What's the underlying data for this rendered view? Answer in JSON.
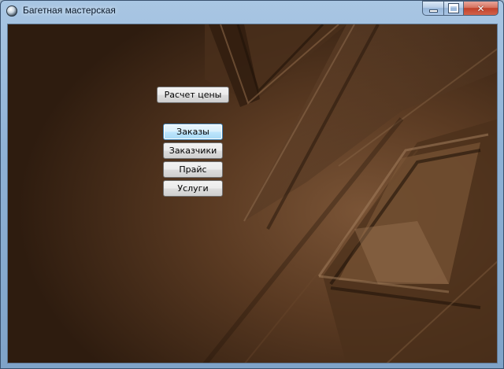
{
  "window": {
    "title": "Багетная мастерская",
    "controls": {
      "minimize": "minimize",
      "maximize": "maximize",
      "close": "✕"
    }
  },
  "main": {
    "price_button": "Расчет цены",
    "menu": [
      {
        "id": "orders",
        "label": "Заказы",
        "focused": true
      },
      {
        "id": "customers",
        "label": "Заказчики",
        "focused": false
      },
      {
        "id": "price-list",
        "label": "Прайс",
        "focused": false
      },
      {
        "id": "services",
        "label": "Услуги",
        "focused": false
      }
    ]
  },
  "colors": {
    "background_dark": "#3a2414",
    "background_light": "#7a5436",
    "focus_border": "#3c7fb1"
  }
}
